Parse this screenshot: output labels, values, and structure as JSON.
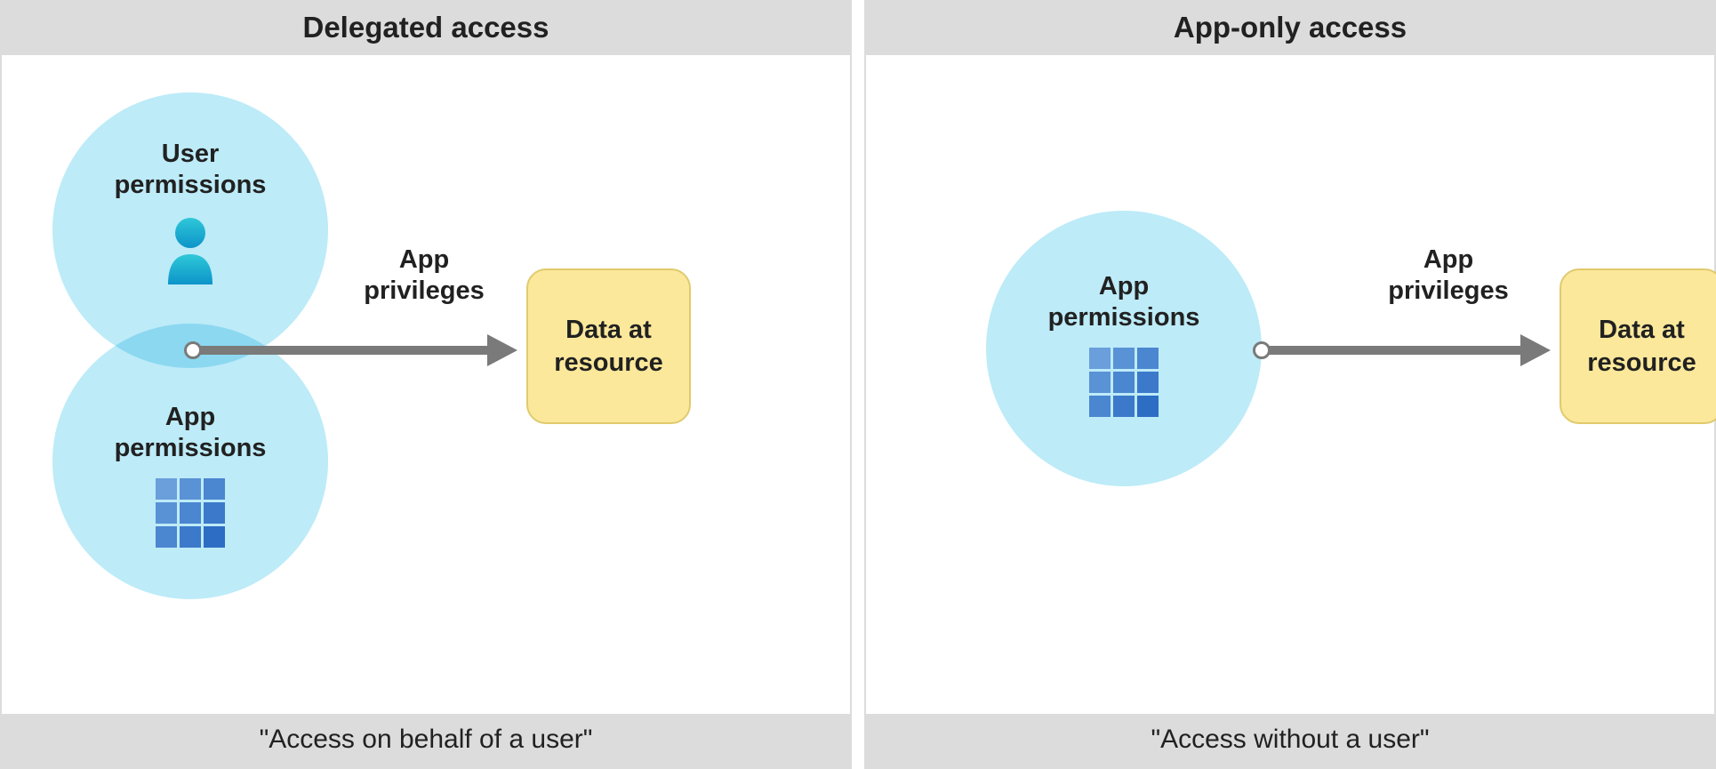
{
  "panels": {
    "left": {
      "title": "Delegated access",
      "footer": "\"Access on behalf of a user\"",
      "user_circle_label": "User\npermissions",
      "app_circle_label": "App\npermissions",
      "arrow_label": "App\nprivileges",
      "data_box_label": "Data at\nresource"
    },
    "right": {
      "title": "App-only access",
      "footer": "\"Access without a user\"",
      "app_circle_label": "App\npermissions",
      "arrow_label": "App\nprivileges",
      "data_box_label": "Data at\nresource"
    }
  },
  "icons": {
    "user": "user-icon",
    "app_grid": "app-grid-icon"
  },
  "colors": {
    "circle_fill": "#bdebf8",
    "data_box_fill": "#fbe89b",
    "data_box_border": "#e0ca6e",
    "arrow": "#7a7a7a",
    "header_bg": "#dcdcdc",
    "user_icon_gradient_top": "#2fc8d8",
    "user_icon_gradient_bottom": "#0d94c9",
    "grid_light": "#6a9fdc",
    "grid_dark": "#2d6dc4"
  }
}
